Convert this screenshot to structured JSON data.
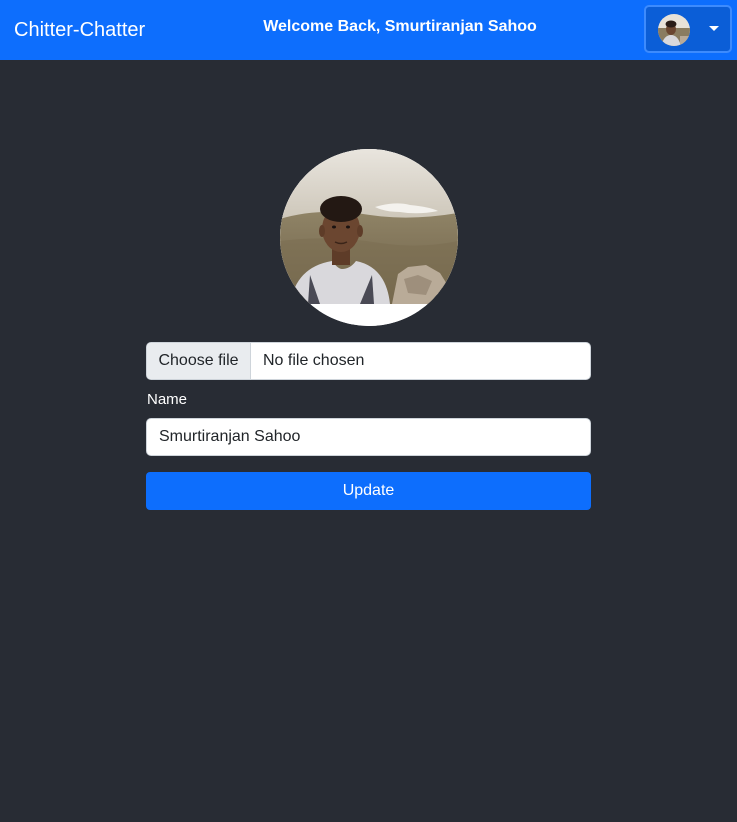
{
  "navbar": {
    "brand": "Chitter-Chatter",
    "welcome": "Welcome Back, Smurtiranjan Sahoo",
    "user_menu": {
      "avatar": "user-avatar",
      "toggle_icon": "caret-down-icon"
    }
  },
  "profile": {
    "photo": "profile-photo",
    "file_button_label": "Choose file",
    "file_status": "No file chosen",
    "name_label": "Name",
    "name_value": "Smurtiranjan Sahoo",
    "update_label": "Update"
  },
  "colors": {
    "background": "#282c34",
    "navbar": "#0d6efd",
    "primary_button": "#0d6efd"
  }
}
